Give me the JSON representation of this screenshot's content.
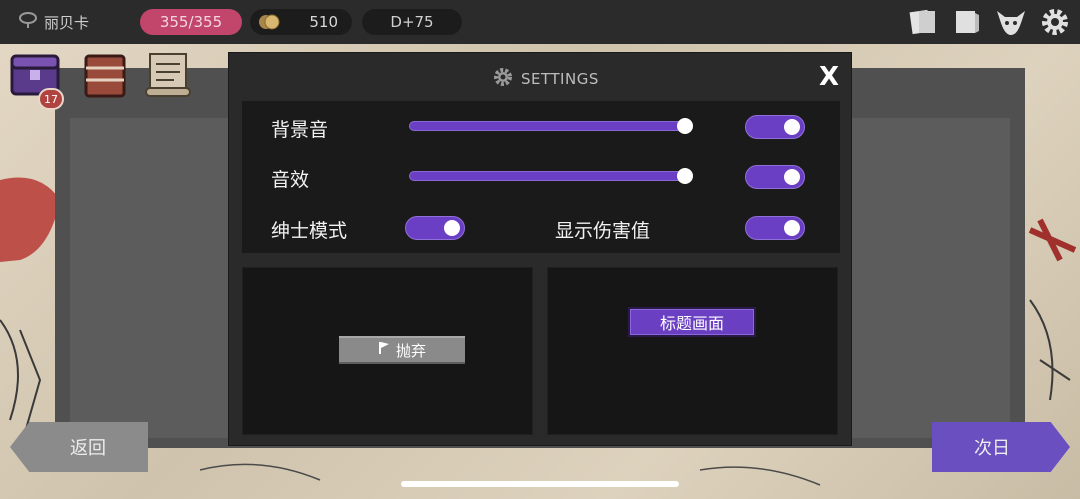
{
  "topbar": {
    "player_name": "丽贝卡",
    "hp": "355/355",
    "gold": "510",
    "day": "D+75",
    "icons": [
      "cards-icon",
      "journal-icon",
      "demon-mask-icon",
      "gear-icon"
    ]
  },
  "items": {
    "chest_badge": "17",
    "slots": [
      "purple-chest-icon",
      "book-chest-icon",
      "scroll-icon"
    ]
  },
  "settings": {
    "title": "SETTINGS",
    "close_label": "X",
    "bgm_label": "背景音",
    "bgm_volume": 1.0,
    "bgm_enabled": true,
    "sfx_label": "音效",
    "sfx_volume": 1.0,
    "sfx_enabled": true,
    "gentleman_label": "绅士模式",
    "gentleman_enabled": true,
    "damage_label": "显示伤害值",
    "damage_enabled": true,
    "abandon_label": "抛弃",
    "title_screen_label": "标题画面"
  },
  "nav": {
    "back_label": "返回",
    "next_label": "次日"
  },
  "colors": {
    "accent": "#6b3fc4",
    "hp_pill": "#c2456b",
    "modal_bg": "#2a2a2a",
    "topbar_bg": "#2b2b2b"
  }
}
